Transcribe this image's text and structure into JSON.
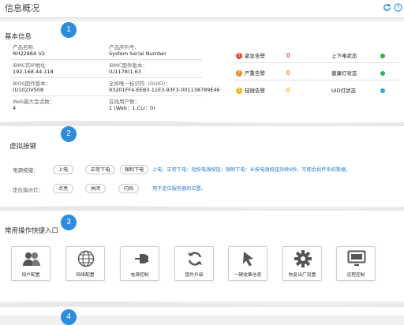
{
  "page": {
    "title": "信息概况"
  },
  "toolbar": {
    "refresh_icon": "refresh-icon",
    "help_icon": "help-icon"
  },
  "sections": [
    {
      "badge": "1",
      "title": "基本信息"
    },
    {
      "badge": "2",
      "title": "虚拟按键"
    },
    {
      "badge": "3",
      "title": "常用操作快捷入口"
    },
    {
      "badge": "4",
      "title": ""
    }
  ],
  "basic_info": {
    "left": [
      {
        "label": "产品名称:",
        "value": "RH2288A V2"
      },
      {
        "label": "iBMC的IP地址:",
        "value": "192.168.44.118"
      },
      {
        "label": "BIOS固件版本：",
        "value": "(U102)V508"
      },
      {
        "label": "Web最大会话数：",
        "value": "4"
      }
    ],
    "middle": [
      {
        "label": "产品序列号:",
        "value": "System Serial Number"
      },
      {
        "label": "iBMC固件版本：",
        "value": "(U1178)1.63"
      },
      {
        "label": "全局唯一标识符（GUID）：",
        "value": "93201FF4-EEB3-11E3-93F3-001138789E46"
      },
      {
        "label": "在线用户数：",
        "value": "1 (Web：1,CLI：0)"
      }
    ],
    "alarms": [
      {
        "icon": "!",
        "color": "#e94c3c",
        "label": "紧急告警",
        "count": "0"
      },
      {
        "icon": "!",
        "color": "#f08a24",
        "label": "严重告警",
        "count": "0"
      },
      {
        "icon": "!",
        "color": "#f2b61b",
        "label": "轻微告警",
        "count": "0"
      }
    ],
    "status": [
      {
        "label": "上下电状态",
        "color": "#2fb44a"
      },
      {
        "label": "健康灯状态",
        "color": "#2fb44a"
      },
      {
        "label": "UID灯状态",
        "color": "#3aa5d8"
      }
    ]
  },
  "virtual_buttons": {
    "power_label": "电源按键：",
    "power_buttons": [
      "上电",
      "正常下电",
      "强制下电"
    ],
    "power_hint": "上电，正常下电：短按电源按钮；强制下电：长按电源按钮持续6秒，可能会损坏系统数据。",
    "uid_label": "定位指示灯：",
    "uid_buttons": [
      "点亮",
      "关闭",
      "闪烁"
    ],
    "uid_hint": "用于定位服务器的位置。"
  },
  "quick_entries": [
    {
      "icon": "users-icon",
      "label": "用户配置"
    },
    {
      "icon": "globe-icon",
      "label": "网络配置"
    },
    {
      "icon": "power-plug-icon",
      "label": "电源控制"
    },
    {
      "icon": "firmware-upgrade-icon",
      "label": "固件升级"
    },
    {
      "icon": "cursor-icon",
      "label": "一键收集信息"
    },
    {
      "icon": "gear-icon",
      "label": "恢复出厂设置"
    },
    {
      "icon": "monitor-icon",
      "label": "远程控制"
    }
  ],
  "colors": {
    "accent": "#2d8cdc",
    "critical": "#e94c3c",
    "major": "#f08a24",
    "minor": "#f2b61b",
    "ok": "#2fb44a"
  }
}
